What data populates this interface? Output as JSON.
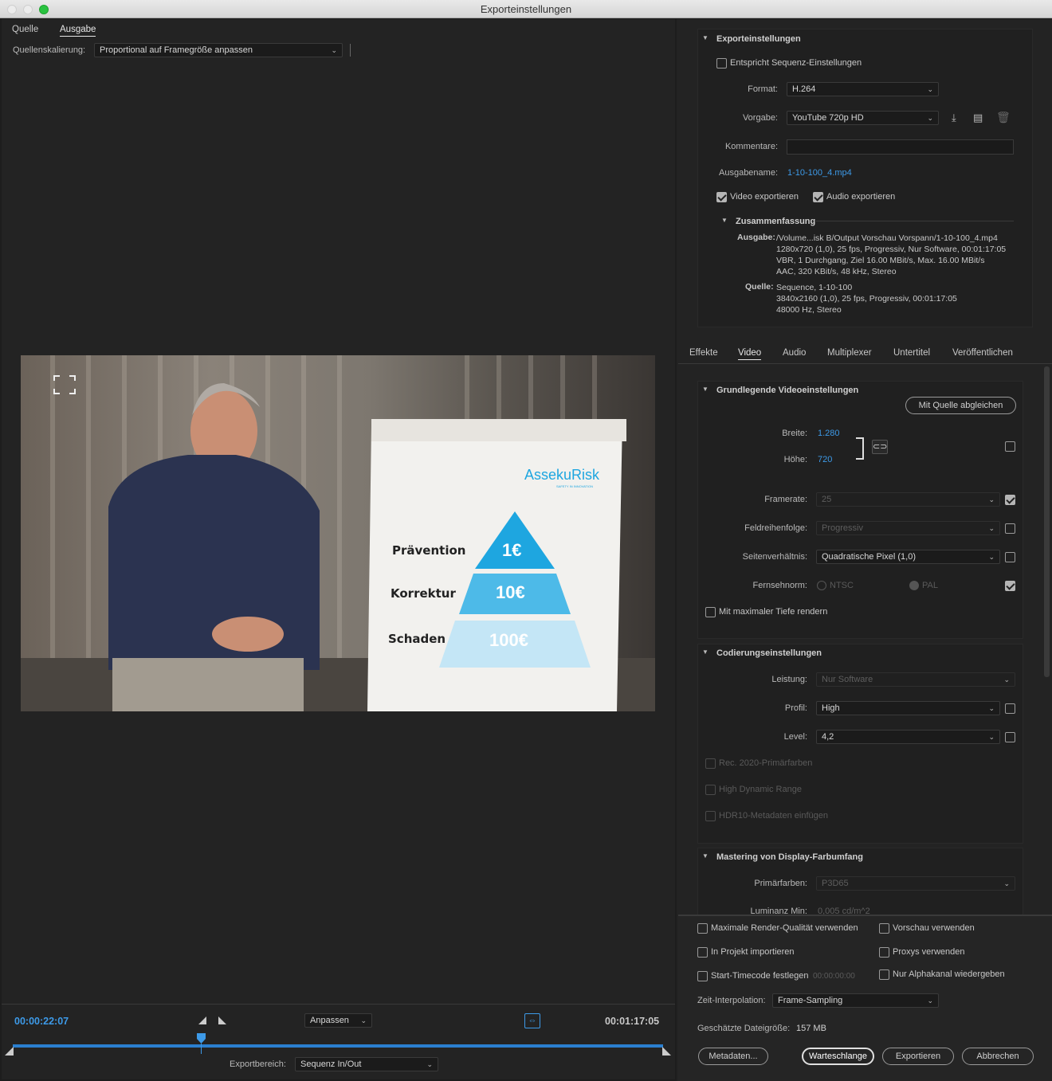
{
  "window": {
    "title": "Exporteinstellungen"
  },
  "left": {
    "tabs": [
      "Quelle",
      "Ausgabe"
    ],
    "scaling_label": "Quellenskalierung:",
    "scaling_value": "Proportional auf Framegröße anpassen",
    "video_frame": {
      "logo_text": "AssekuRisk",
      "logo_tagline": "SAFETY IN INNOVATION",
      "rows": [
        {
          "label": "Prävention",
          "value": "1€"
        },
        {
          "label": "Korrektur",
          "value": "10€"
        },
        {
          "label": "Schaden",
          "value": "100€"
        }
      ]
    },
    "timecode_current": "00:00:22:07",
    "timecode_total": "00:01:17:05",
    "fit_value": "Anpassen",
    "export_range_label": "Exportbereich:",
    "export_range_value": "Sequenz In/Out",
    "playhead_fraction": 0.29
  },
  "export": {
    "section_title": "Exporteinstellungen",
    "match_sequence": "Entspricht Sequenz-Einstellungen",
    "format_label": "Format:",
    "format_value": "H.264",
    "preset_label": "Vorgabe:",
    "preset_value": "YouTube 720p HD",
    "comments_label": "Kommentare:",
    "comments_value": "",
    "output_name_label": "Ausgabename:",
    "output_name_value": "1-10-100_4.mp4",
    "video_export": "Video exportieren",
    "audio_export": "Audio exportieren",
    "summary_title": "Zusammenfassung",
    "output_label": "Ausgabe:",
    "output_lines": [
      "/Volume...isk B/Output Vorschau Vorspann/1-10-100_4.mp4",
      "1280x720 (1,0), 25 fps, Progressiv, Nur Software, 00:01:17:05",
      "VBR, 1 Durchgang, Ziel 16.00 MBit/s, Max. 16.00 MBit/s",
      "AAC, 320 KBit/s, 48 kHz, Stereo"
    ],
    "source_label": "Quelle:",
    "source_lines": [
      "Sequence, 1-10-100",
      "3840x2160 (1,0), 25 fps, Progressiv, 00:01:17:05",
      "48000 Hz, Stereo"
    ]
  },
  "tabs2": [
    "Effekte",
    "Video",
    "Audio",
    "Multiplexer",
    "Untertitel",
    "Veröffentlichen"
  ],
  "video": {
    "section_title": "Grundlegende Videoeinstellungen",
    "match_source_button": "Mit Quelle abgleichen",
    "width_label": "Breite:",
    "width_value": "1.280",
    "height_label": "Höhe:",
    "height_value": "720",
    "framerate_label": "Framerate:",
    "framerate_value": "25",
    "field_order_label": "Feldreihenfolge:",
    "field_order_value": "Progressiv",
    "aspect_label": "Seitenverhältnis:",
    "aspect_value": "Quadratische Pixel (1,0)",
    "tv_label": "Fernsehnorm:",
    "ntsc": "NTSC",
    "pal": "PAL",
    "max_depth": "Mit maximaler Tiefe rendern",
    "coding_title": "Codierungseinstellungen",
    "performance_label": "Leistung:",
    "performance_value": "Nur Software",
    "profile_label": "Profil:",
    "profile_value": "High",
    "level_label": "Level:",
    "level_value": "4,2",
    "rec2020": "Rec. 2020-Primärfarben",
    "hdr": "High Dynamic Range",
    "hdr10": "HDR10-Metadaten einfügen",
    "mastering_title": "Mastering von Display-Farbumfang",
    "primaries_label": "Primärfarben:",
    "primaries_value": "P3D65",
    "lum_label": "Luminanz Min:",
    "lum_value": "0,005 cd/m^2"
  },
  "bottom": {
    "max_render": "Maximale Render-Qualität verwenden",
    "use_preview": "Vorschau verwenden",
    "import_project": "In Projekt importieren",
    "use_proxies": "Proxys verwenden",
    "start_timecode": "Start-Timecode festlegen",
    "start_timecode_value": "00:00:00:00",
    "alpha_only": "Nur Alphakanal wiedergeben",
    "interp_label": "Zeit-Interpolation:",
    "interp_value": "Frame-Sampling",
    "filesize_label": "Geschätzte Dateigröße:",
    "filesize_value": "157 MB",
    "btn_metadata": "Metadaten...",
    "btn_queue": "Warteschlange",
    "btn_export": "Exportieren",
    "btn_cancel": "Abbrechen"
  }
}
